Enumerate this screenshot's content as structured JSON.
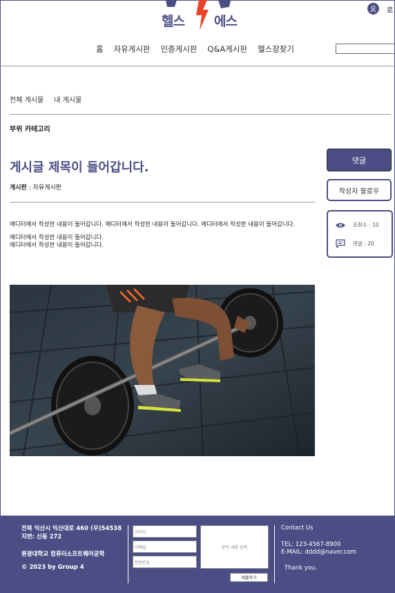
{
  "header": {
    "logo_left": "헬스",
    "logo_right": "에스",
    "login_label": "로",
    "nav": [
      "홈",
      "자유게시판",
      "인증게시판",
      "Q&A게시판",
      "헬스장찾기"
    ],
    "search_placeholder": ""
  },
  "tabs": [
    "전체 게시물",
    "내 게시물"
  ],
  "category": "부위 카테고리",
  "post": {
    "title": "게시글 제목이 들어갑니다.",
    "board_label": "게시판",
    "board_value": " : 자유게시판",
    "paragraphs": [
      "에디터에서 작성한 내용이 들어갑니다. 에디터에서 작성한 내용이 들어갑니다. 에디터에서 작성한 내용이 들어갑니다.",
      "에디터에서 작성한 내용이 들어갑니다.",
      "에디터에서 작성한 내용이 들어갑니다."
    ]
  },
  "side": {
    "comment_button": "댓글",
    "follow_button": "작성자 팔로우",
    "views": "조회수 : 10",
    "comments": "댓글 : 20"
  },
  "footer": {
    "address_1": "전북 익산시 익산대로 460 (우)54538",
    "address_2": "지번: 신동 272",
    "university": "원광대학교 컴퓨터소프트웨어공학",
    "copyright": "© 2023 by Group 4",
    "id_placeholder": "아이디",
    "email_placeholder": "이메일",
    "phone_placeholder": "전화번호",
    "inquiry_placeholder": "문의 내용 입력",
    "submit_label": "제출하기",
    "contact_title": "Contact Us",
    "tel": "TEL: 123-4567-8900",
    "email": "E-MAIL: dddd@naver.com",
    "thanks": "Thank you."
  },
  "colors": {
    "accent": "#4a4e85",
    "logo_bolt": "#e8442c"
  }
}
